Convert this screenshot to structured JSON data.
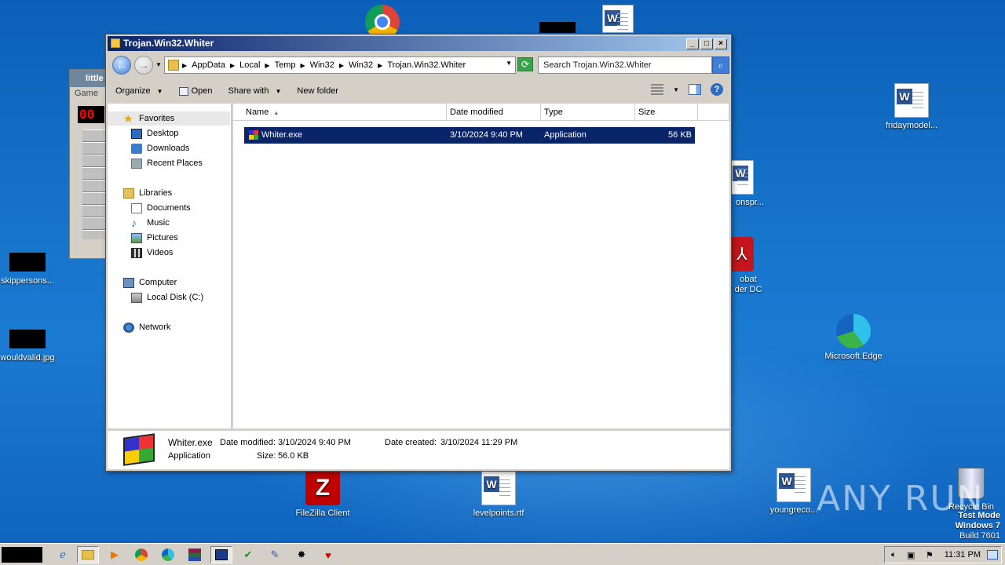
{
  "desktop": {
    "icons": [
      {
        "id": "fridaymodel",
        "label": "fridaymodel..."
      },
      {
        "id": "onspr",
        "label": "onspr..."
      },
      {
        "id": "acrobat",
        "label": "obat\nder DC"
      },
      {
        "id": "edge",
        "label": "Microsoft Edge"
      },
      {
        "id": "skippersons",
        "label": "skippersons..."
      },
      {
        "id": "wouldvalid",
        "label": "wouldvalid.jpg"
      },
      {
        "id": "filezilla",
        "label": "FileZilla Client"
      },
      {
        "id": "levelpoints",
        "label": "levelpoints.rtf"
      },
      {
        "id": "youngreco",
        "label": "youngreco..."
      },
      {
        "id": "recycle",
        "label": "Recycle Bin"
      }
    ],
    "watermark": {
      "line1": "Test Mode",
      "line2": "Windows 7",
      "line3": "Build 7601"
    },
    "anyrun_text": "ANY RUN"
  },
  "bg_window": {
    "title": "little",
    "menu": "Game",
    "counter": "00"
  },
  "window": {
    "title": "Trojan.Win32.Whiter",
    "breadcrumbs": [
      "AppData",
      "Local",
      "Temp",
      "Win32",
      "Win32",
      "Trojan.Win32.Whiter"
    ],
    "search_placeholder": "Search Trojan.Win32.Whiter",
    "toolbar": {
      "organize": "Organize",
      "open": "Open",
      "share": "Share with",
      "new_folder": "New folder"
    },
    "nav": {
      "favorites": "Favorites",
      "desktop": "Desktop",
      "downloads": "Downloads",
      "recent": "Recent Places",
      "libraries": "Libraries",
      "documents": "Documents",
      "music": "Music",
      "pictures": "Pictures",
      "videos": "Videos",
      "computer": "Computer",
      "local_disk": "Local Disk (C:)",
      "network": "Network"
    },
    "columns": {
      "name": "Name",
      "date": "Date modified",
      "type": "Type",
      "size": "Size"
    },
    "files": [
      {
        "name": "Whiter.exe",
        "date": "3/10/2024 9:40 PM",
        "type": "Application",
        "size": "56 KB"
      }
    ],
    "details": {
      "name": "Whiter.exe",
      "type": "Application",
      "modified_label": "Date modified:",
      "modified": "3/10/2024 9:40 PM",
      "size_label": "Size:",
      "size": "56.0 KB",
      "created_label": "Date created:",
      "created": "3/10/2024 11:29 PM"
    }
  },
  "taskbar": {
    "clock": "11:31 PM"
  }
}
